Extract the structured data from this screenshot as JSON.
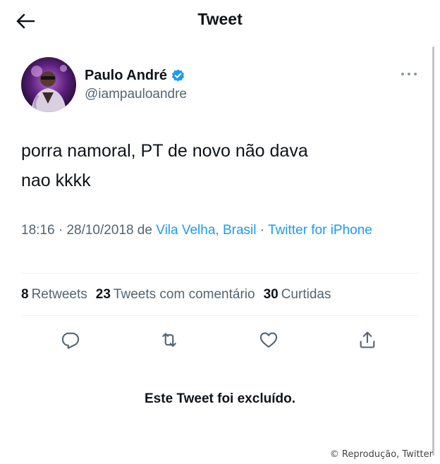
{
  "header": {
    "title": "Tweet",
    "back_icon": "arrow-left-icon"
  },
  "tweet": {
    "author": {
      "name": "Paulo André",
      "handle": "@iampauloandre",
      "verified": true
    },
    "text_line1": "porra namoral, PT de novo não dava",
    "text_line2": "nao kkkk",
    "meta": {
      "time": "18:16",
      "sep1": " · ",
      "date": "28/10/2018",
      "from": " de ",
      "location": "Vila Velha, Brasil",
      "sep2": " · ",
      "source": "Twitter for iPhone"
    },
    "stats": {
      "retweets_count": "8",
      "retweets_label": "Retweets",
      "quotes_count": "23",
      "quotes_label": "Tweets com comentário",
      "likes_count": "30",
      "likes_label": "Curtidas"
    },
    "actions": {
      "reply_icon": "reply-icon",
      "retweet_icon": "retweet-icon",
      "like_icon": "heart-icon",
      "share_icon": "share-icon"
    }
  },
  "deleted_notice": "Este Tweet foi excluído.",
  "credit": "© Reprodução, Twitter",
  "colors": {
    "link": "#1d9bf0",
    "verified": "#1d9bf0",
    "muted_text": "#536471",
    "primary_text": "#0f1419",
    "icon": "#536471"
  }
}
